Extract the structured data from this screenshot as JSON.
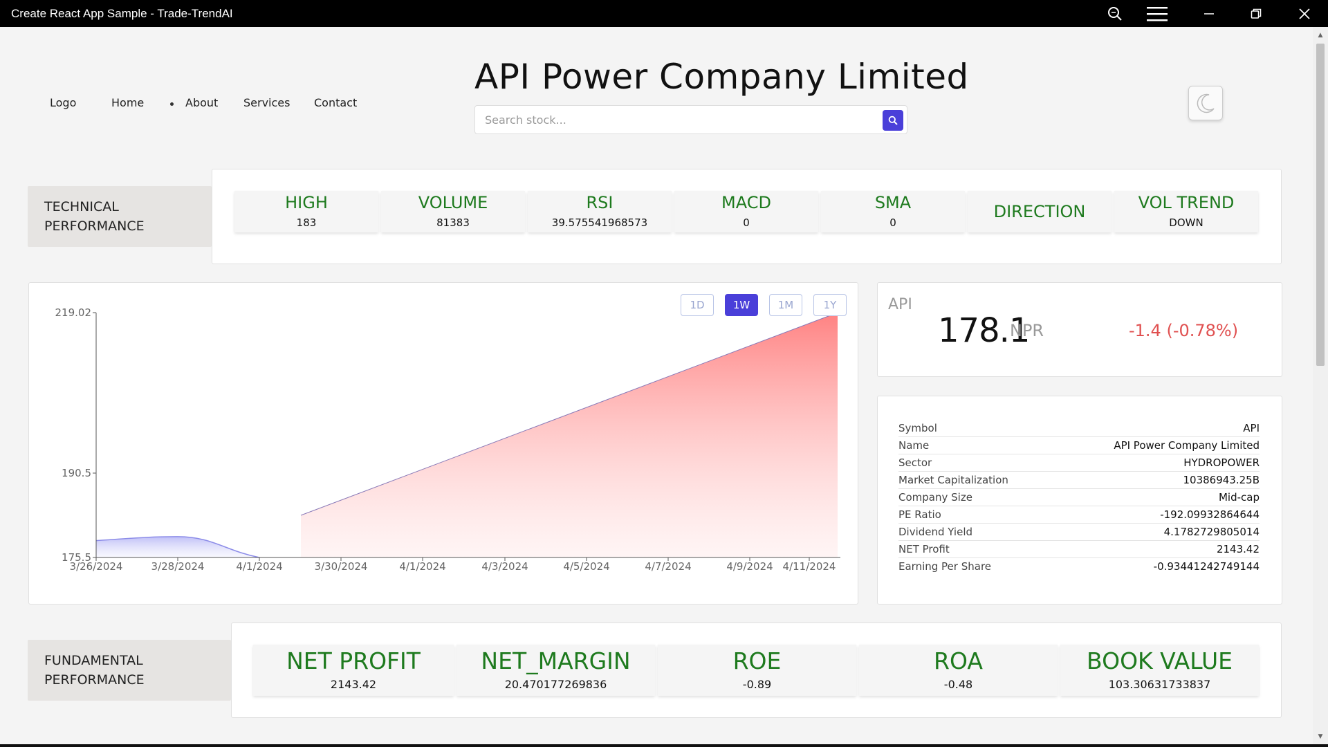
{
  "window": {
    "title": "Create React App Sample - Trade-TrendAI"
  },
  "nav": {
    "logo": "Logo",
    "home": "Home",
    "about": "About",
    "services": "Services",
    "contact": "Contact"
  },
  "header": {
    "company_title": "API Power Company Limited",
    "search_placeholder": "Search stock..."
  },
  "technical": {
    "label_line1": "TECHNICAL",
    "label_line2": "PERFORMANCE",
    "metrics": [
      {
        "label": "HIGH",
        "value": "183"
      },
      {
        "label": "VOLUME",
        "value": "81383"
      },
      {
        "label": "RSI",
        "value": "39.575541968573"
      },
      {
        "label": "MACD",
        "value": "0"
      },
      {
        "label": "SMA",
        "value": "0"
      },
      {
        "label": "DIRECTION",
        "value": ""
      },
      {
        "label": "VOL TREND",
        "value": "DOWN"
      }
    ]
  },
  "chart_controls": {
    "ranges": [
      "1D",
      "1W",
      "1M",
      "1Y"
    ],
    "active": "1W"
  },
  "chart_data": {
    "type": "area",
    "y_ticks": [
      "219.02",
      "190.5",
      "175.5"
    ],
    "x_ticks": [
      "3/26/2024",
      "3/28/2024",
      "4/1/2024",
      "3/30/2024",
      "4/1/2024",
      "4/3/2024",
      "4/5/2024",
      "4/7/2024",
      "4/9/2024",
      "4/11/2024"
    ],
    "ylim": [
      175.5,
      219.02
    ],
    "series": [
      {
        "color": "#8c8ce8",
        "x": [
          "3/26/2024",
          "3/28/2024",
          "4/1/2024"
        ],
        "values": [
          178.5,
          179.2,
          175.5
        ]
      },
      {
        "color": "#f47a7a",
        "x": [
          "3/30/2024",
          "4/11/2024"
        ],
        "values": [
          183.0,
          219.02
        ]
      }
    ],
    "grid": false
  },
  "price": {
    "symbol": "API",
    "value": "178.1",
    "currency": "NPR",
    "change": "-1.4 (-0.78%)"
  },
  "info": [
    {
      "key": "Symbol",
      "value": "API"
    },
    {
      "key": "Name",
      "value": "API Power Company Limited"
    },
    {
      "key": "Sector",
      "value": "HYDROPOWER"
    },
    {
      "key": "Market Capitalization",
      "value": "10386943.25B"
    },
    {
      "key": "Company Size",
      "value": "Mid-cap"
    },
    {
      "key": "PE Ratio",
      "value": "-192.09932864644"
    },
    {
      "key": "Dividend Yield",
      "value": "4.1782729805014"
    },
    {
      "key": "NET Profit",
      "value": "2143.42"
    },
    {
      "key": "Earning Per Share",
      "value": "-0.93441242749144"
    }
  ],
  "fundamental": {
    "label_line1": "FUNDAMENTAL",
    "label_line2": "PERFORMANCE",
    "metrics": [
      {
        "label": "NET PROFIT",
        "value": "2143.42"
      },
      {
        "label": "NET_MARGIN",
        "value": "20.470177269836"
      },
      {
        "label": "ROE",
        "value": "-0.89"
      },
      {
        "label": "ROA",
        "value": "-0.48"
      },
      {
        "label": "BOOK VALUE",
        "value": "103.30631733837"
      }
    ]
  },
  "colors": {
    "accent": "#4a3fd9",
    "metric_label": "#1e7a1e",
    "negative": "#e05050"
  }
}
